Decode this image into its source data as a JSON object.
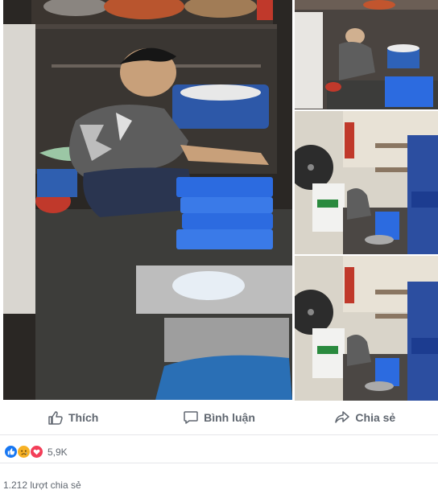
{
  "post": {
    "photos": [
      {
        "alt": ""
      },
      {
        "alt": ""
      },
      {
        "alt": ""
      },
      {
        "alt": ""
      }
    ],
    "actions": {
      "like_label": "Thích",
      "comment_label": "Bình luận",
      "share_label": "Chia sẻ"
    },
    "reactions": {
      "icons": [
        "like-icon",
        "sad-icon",
        "love-icon"
      ],
      "count": "5,9K"
    },
    "share_count": "1.212 lượt chia sẻ"
  },
  "colors": {
    "like_blue": "#1877f2",
    "love_red": "#f33e58",
    "sad_yellow": "#f7b125",
    "text_gray": "#606770"
  }
}
